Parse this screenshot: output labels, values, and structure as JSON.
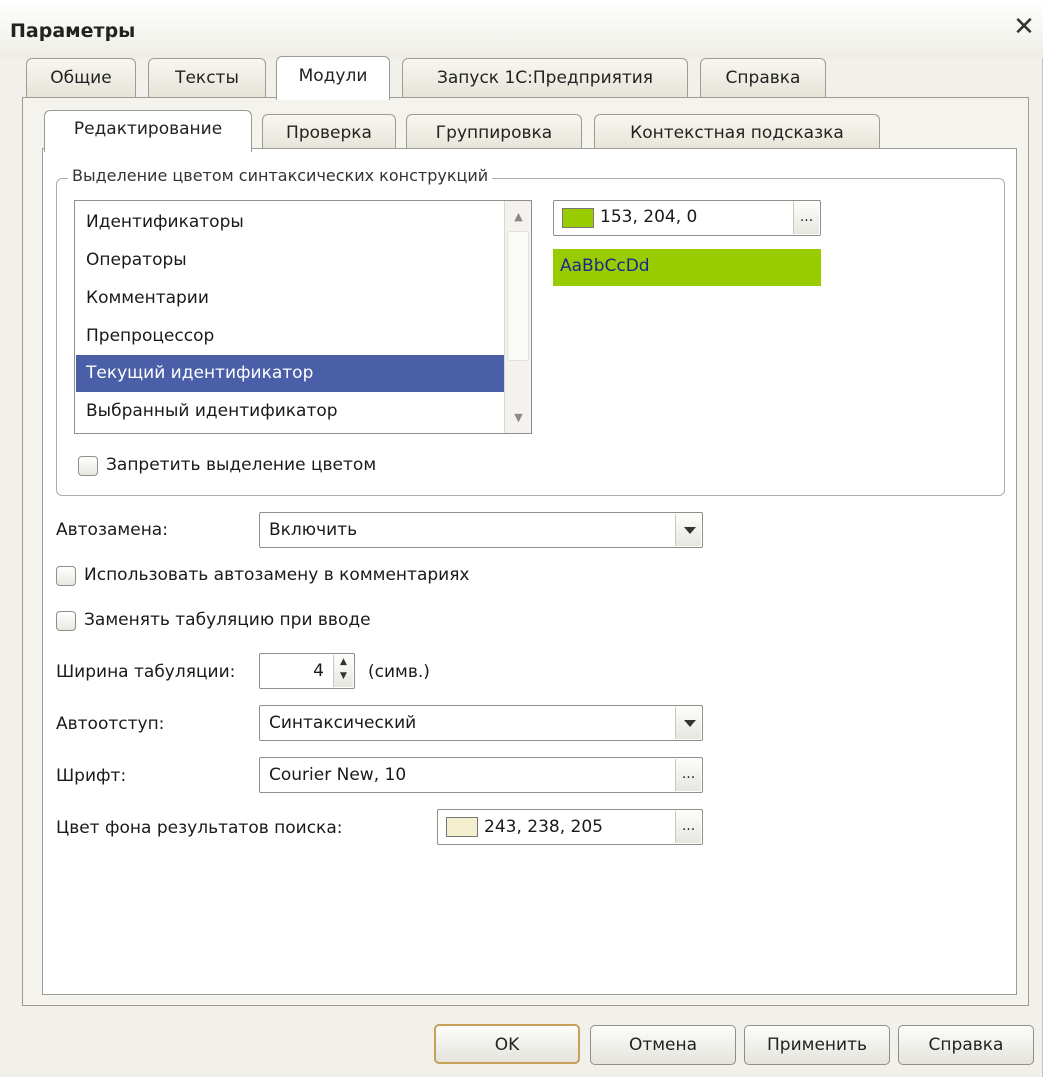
{
  "window": {
    "title": "Параметры"
  },
  "tabs": [
    "Общие",
    "Тексты",
    "Модули",
    "Запуск 1С:Предприятия",
    "Справка"
  ],
  "subtabs": [
    "Редактирование",
    "Проверка",
    "Группировка",
    "Контекстная подсказка"
  ],
  "syntax_group": {
    "title": "Выделение цветом синтаксических конструкций",
    "items": [
      "Идентификаторы",
      "Операторы",
      "Комментарии",
      "Препроцессор",
      "Текущий идентификатор",
      "Выбранный идентификатор"
    ],
    "selected": "Текущий идентификатор",
    "color_value": "153, 204, 0",
    "color": "#99cc00",
    "preview_text": "AaBbCcDd",
    "disable_color_label": "Запретить выделение цветом"
  },
  "autoreplace": {
    "label": "Автозамена:",
    "value": "Включить"
  },
  "use_in_comments_label": "Использовать автозамену в комментариях",
  "replace_tab_label": "Заменять табуляцию при вводе",
  "tab_width": {
    "label": "Ширина табуляции:",
    "value": "4",
    "unit": "(симв.)"
  },
  "autoindent": {
    "label": "Автоотступ:",
    "value": "Синтаксический"
  },
  "font": {
    "label": "Шрифт:",
    "value": "Courier New, 10"
  },
  "search_bg": {
    "label": "Цвет фона результатов поиска:",
    "value": "243, 238, 205",
    "color": "#f3eecd"
  },
  "buttons": {
    "ok": "OK",
    "cancel": "Отмена",
    "apply": "Применить",
    "help": "Справка"
  }
}
